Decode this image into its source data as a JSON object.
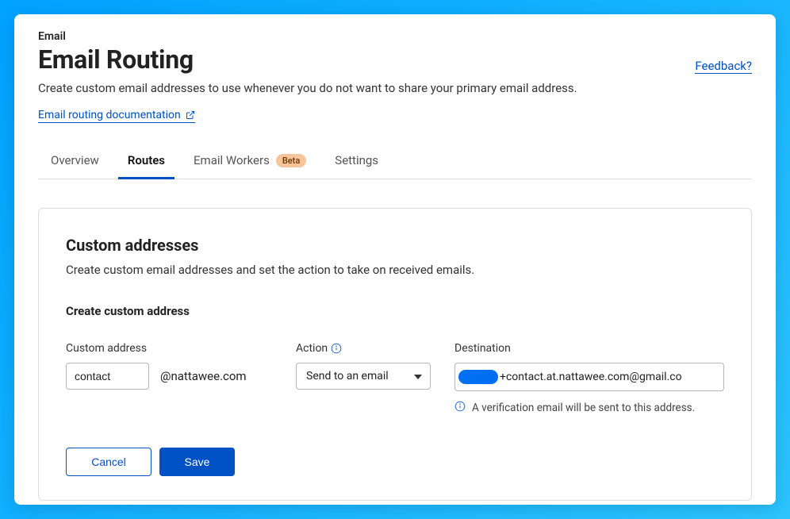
{
  "breadcrumb": "Email",
  "page_title": "Email Routing",
  "page_desc": "Create custom email addresses to use whenever you do not want to share your primary email address.",
  "doc_link_label": "Email routing documentation",
  "feedback_label": "Feedback?",
  "tabs": {
    "overview": "Overview",
    "routes": "Routes",
    "email_workers": "Email Workers",
    "beta_badge": "Beta",
    "settings": "Settings"
  },
  "panel": {
    "title": "Custom addresses",
    "desc": "Create custom email addresses and set the action to take on received emails.",
    "subtitle": "Create custom address",
    "custom_address_label": "Custom address",
    "custom_address_value": "contact",
    "domain_suffix": "@nattawee.com",
    "action_label": "Action",
    "action_value": "Send to an email",
    "destination_label": "Destination",
    "destination_value_suffix": "+contact.at.nattawee.com@gmail.co",
    "verify_note": "A verification email will be sent to this address.",
    "cancel": "Cancel",
    "save": "Save"
  }
}
